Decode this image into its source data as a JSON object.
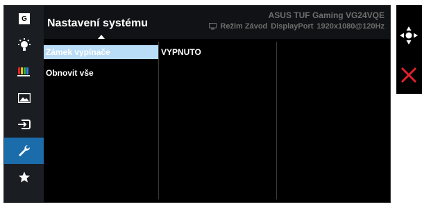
{
  "header": {
    "title": "Nastavení systému",
    "model": "ASUS TUF Gaming VG24VQE",
    "mode": "Režim Závod",
    "input": "DisplayPort",
    "resolution": "1920x1080@120Hz"
  },
  "rail": {
    "items": [
      {
        "icon": "gameplus-icon",
        "text": "G"
      },
      {
        "icon": "brightness-icon"
      },
      {
        "icon": "color-icon"
      },
      {
        "icon": "image-icon"
      },
      {
        "icon": "input-select-icon"
      },
      {
        "icon": "system-setup-icon",
        "active": true
      },
      {
        "icon": "favorite-star-icon"
      }
    ]
  },
  "menu": {
    "items": [
      {
        "label": "Zámek vypínače",
        "selected": true
      },
      {
        "label": "Obnovit vše"
      }
    ],
    "selected_value": "VYPNUTO"
  },
  "side_buttons": [
    "five-way-nav-icon",
    "close-icon"
  ],
  "colors": {
    "accent": "#1b6cab",
    "highlight": "#b9dcf7",
    "close": "#e5202e"
  }
}
